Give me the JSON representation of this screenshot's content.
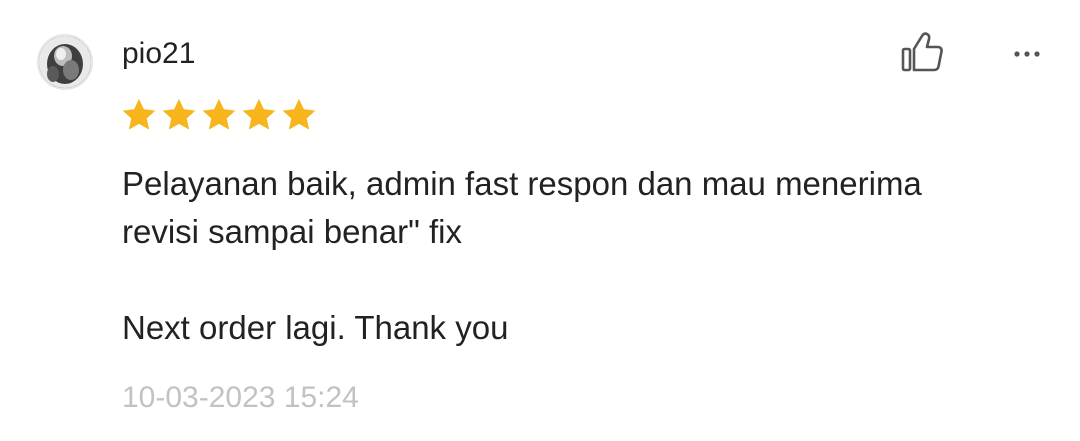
{
  "review": {
    "username": "pio21",
    "rating": 5,
    "rating_max": 5,
    "star_color": "#F7B51B",
    "comment_lines": [
      "Pelayanan baik, admin fast respon dan mau menerima",
      "revisi sampai benar\" fix",
      "",
      "Next order lagi. Thank you"
    ],
    "timestamp": "10-03-2023 15:24"
  },
  "icons": {
    "like": "thumbs-up-icon",
    "more": "more-horizontal-icon",
    "star": "star-icon"
  },
  "colors": {
    "text": "#222222",
    "timestamp": "#C2C2C2",
    "icon": "#555555"
  }
}
